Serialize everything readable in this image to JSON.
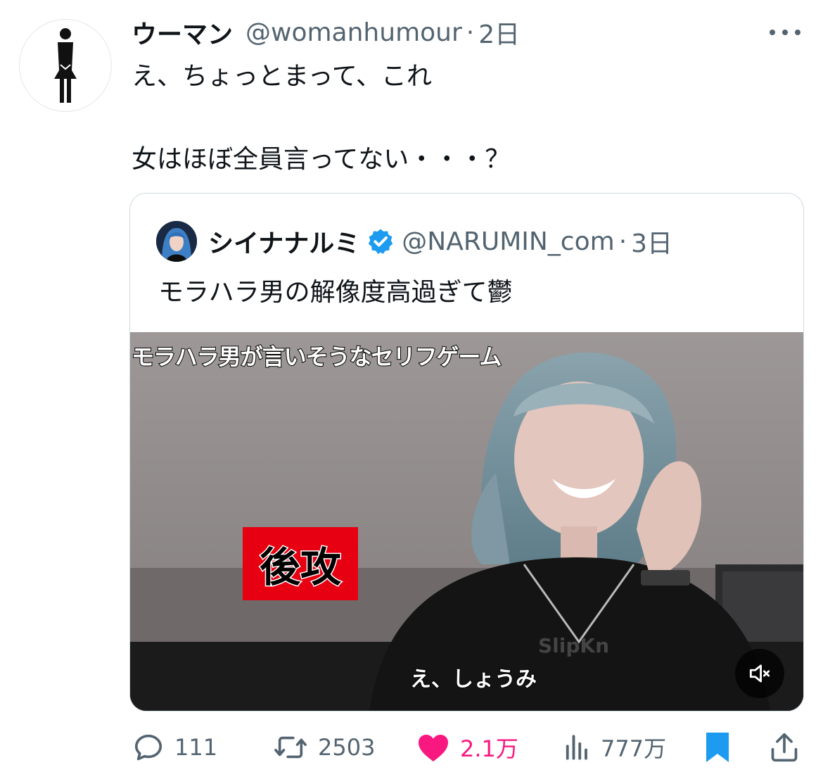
{
  "tweet": {
    "author_name": "ウーマン",
    "handle": "@womanhumour",
    "separator": "·",
    "time": "2日",
    "text_line1": "え、ちょっとまって、これ",
    "text_line2": "女はほぼ全員言ってない・・・？"
  },
  "quoted": {
    "author_name": "シイナナルミ",
    "verified": true,
    "handle": "@NARUMIN_com",
    "separator": "·",
    "time": "3日",
    "text": "モラハラ男の解像度高過ぎて鬱",
    "video": {
      "overlay_title": "モラハラ男が言いそうなセリフゲーム",
      "badge": "後攻",
      "subtitle": "え、しょうみ",
      "muted": true
    }
  },
  "actions": {
    "replies": "111",
    "retweets": "2503",
    "likes": "2.1万",
    "views": "777万",
    "liked": true,
    "bookmarked": true
  },
  "colors": {
    "text_primary": "#0f1419",
    "text_secondary": "#536471",
    "like": "#f91880",
    "accent_blue": "#1d9bf0",
    "border": "#cfd9de"
  },
  "icons": {
    "avatar": "woman-symbol-icon",
    "more": "more-dots-icon",
    "verified": "verified-badge-icon",
    "mute": "speaker-muted-icon",
    "reply": "reply-bubble-icon",
    "retweet": "retweet-icon",
    "like": "heart-icon",
    "views": "views-bar-icon",
    "bookmark": "bookmark-icon",
    "share": "share-icon"
  }
}
